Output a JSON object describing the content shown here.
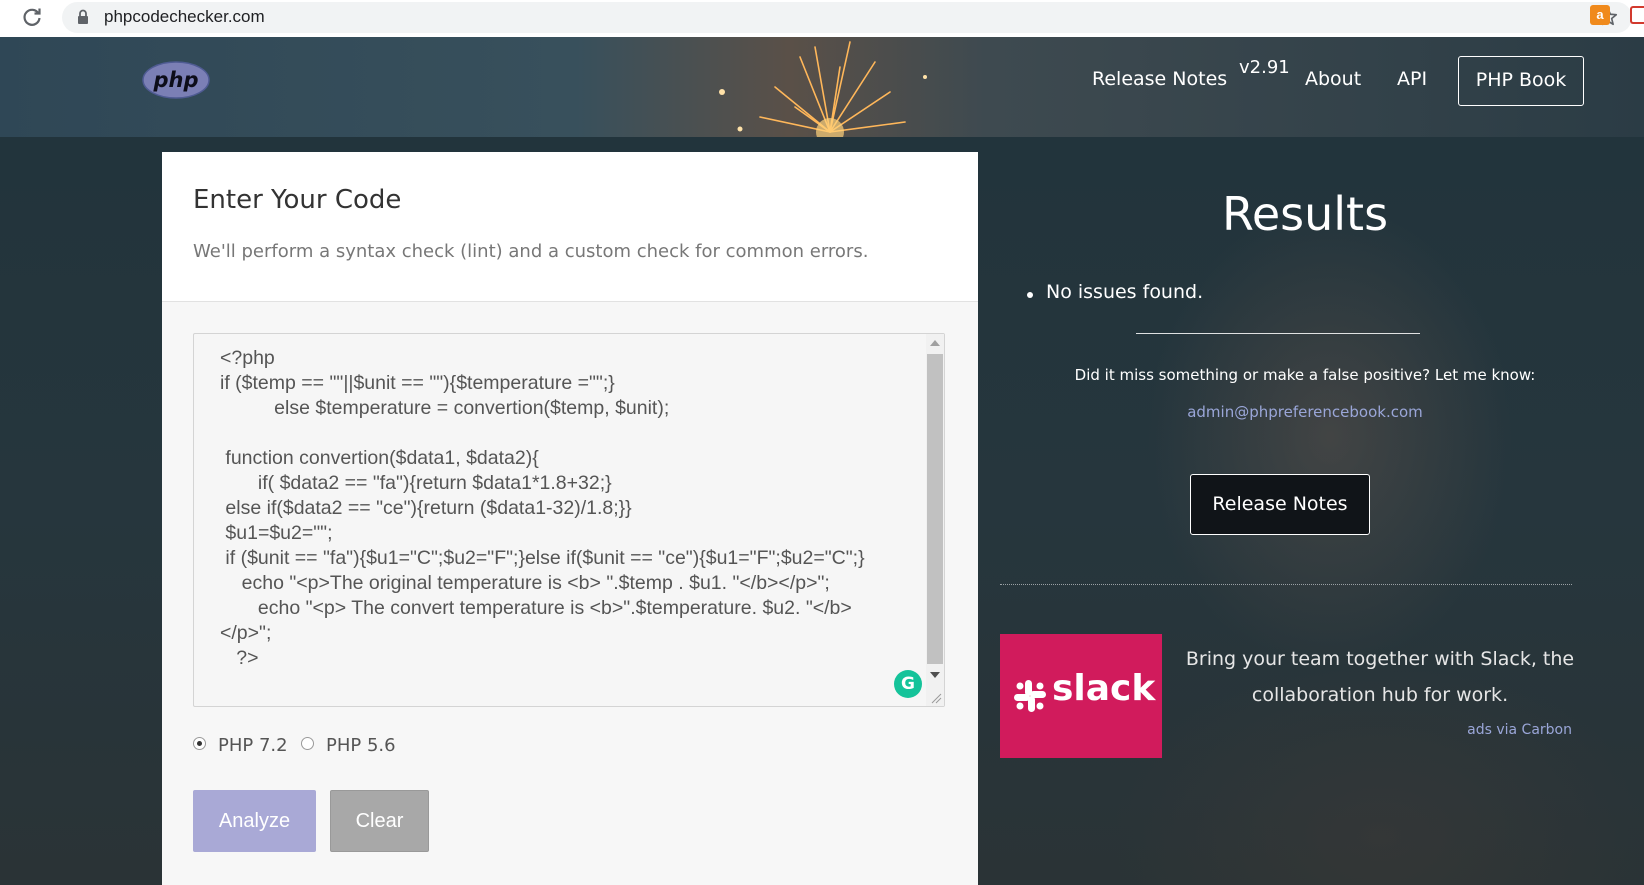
{
  "browser": {
    "url": "phpcodechecker.com",
    "icons": [
      "reload-icon",
      "lock-icon",
      "bookmark-star-icon",
      "extension-icon"
    ]
  },
  "header": {
    "logo": "php",
    "nav": {
      "release_notes": "Release Notes",
      "version": "v2.91",
      "about": "About",
      "api": "API",
      "php_book": "PHP Book"
    }
  },
  "editor": {
    "title": "Enter Your Code",
    "subtitle": "We'll perform a syntax check (lint) and a custom check for common errors.",
    "code": "<?php\nif ($temp == \"\"||$unit == \"\"){$temperature =\"\";}\n          else $temperature = convertion($temp, $unit);\n\n function convertion($data1, $data2){\n       if( $data2 == \"fa\"){return $data1*1.8+32;}\n else if($data2 == \"ce\"){return ($data1-32)/1.8;}}\n $u1=$u2=\"\";\n if ($unit == \"fa\"){$u1=\"C\";$u2=\"F\";}else if($unit == \"ce\"){$u1=\"F\";$u2=\"C\";}\n    echo \"<p>The original temperature is <b> \".$temp . $u1. \"</b></p>\";\n       echo \"<p> The convert temperature is <b>\".$temperature. $u2. \"</b>\n</p>\";\n   ?>",
    "php_versions": [
      {
        "label": "PHP 7.2",
        "selected": true
      },
      {
        "label": "PHP 5.6",
        "selected": false
      }
    ],
    "analyze_label": "Analyze",
    "clear_label": "Clear"
  },
  "results": {
    "title": "Results",
    "items": [
      "No issues found."
    ],
    "feedback_prompt": "Did it miss something or make a false positive? Let me know:",
    "feedback_email": "admin@phpreferencebook.com",
    "release_notes_label": "Release Notes"
  },
  "ad": {
    "brand": "slack",
    "text": "Bring your team together with Slack, the collaboration hub for work.",
    "via": "ads via Carbon"
  },
  "colors": {
    "accent_button": "#a9a9d6",
    "clear_button": "#a8a8a8",
    "link": "#9aa6d8",
    "slack_bg": "#d11b5c",
    "grammarly": "#15c39a"
  }
}
